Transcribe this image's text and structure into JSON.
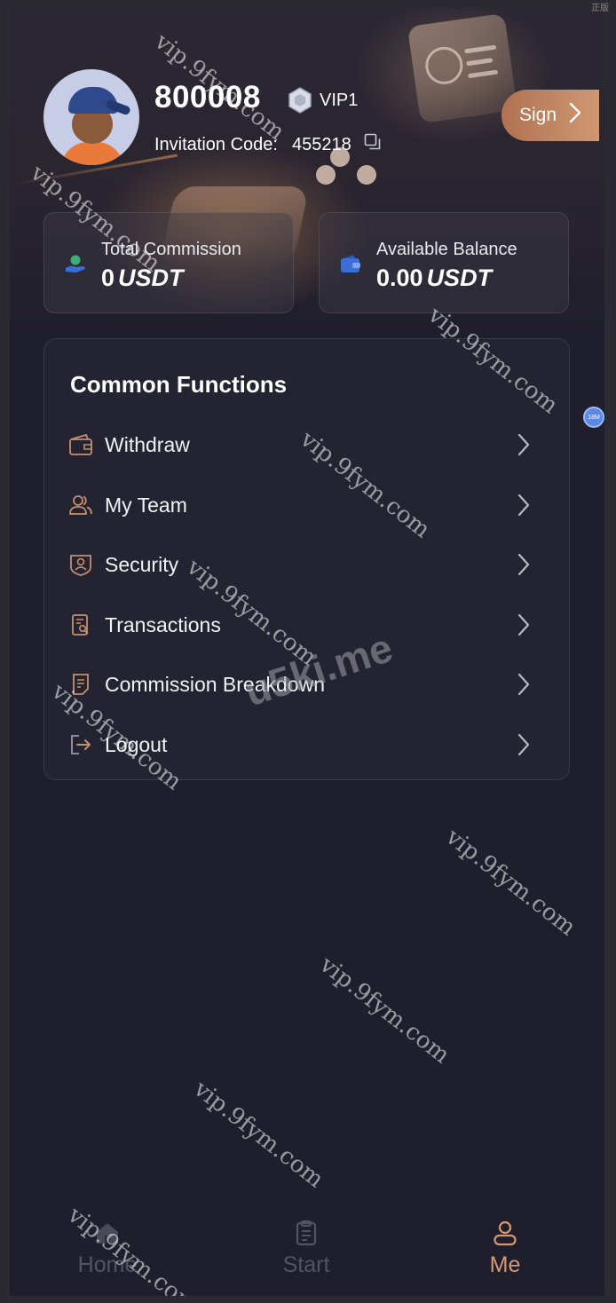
{
  "profile": {
    "user_id": "800008",
    "vip_level": "VIP1",
    "invitation_label": "Invitation Code:",
    "invitation_code": "455218"
  },
  "sign": {
    "label": "Sign"
  },
  "stats": {
    "total_commission": {
      "label": "Total Commission",
      "value": "0",
      "unit": "USDT"
    },
    "available_balance": {
      "label": "Available Balance",
      "value": "0.00",
      "unit": "USDT"
    }
  },
  "functions": {
    "title": "Common Functions",
    "items": [
      {
        "label": "Withdraw",
        "icon": "wallet-icon"
      },
      {
        "label": "My Team",
        "icon": "team-icon"
      },
      {
        "label": "Security",
        "icon": "shield-user-icon"
      },
      {
        "label": "Transactions",
        "icon": "search-document-icon"
      },
      {
        "label": "Commission Breakdown",
        "icon": "list-document-icon"
      },
      {
        "label": "Logout",
        "icon": "logout-icon"
      }
    ]
  },
  "float_badge": "18M",
  "tabs": [
    {
      "label": "Home",
      "icon": "home-icon",
      "active": false
    },
    {
      "label": "Start",
      "icon": "clipboard-icon",
      "active": false
    },
    {
      "label": "Me",
      "icon": "user-icon",
      "active": true
    }
  ],
  "colors": {
    "accent": "#d69a72",
    "background": "#1f1e2c",
    "card": "#242331"
  },
  "overlay": {
    "corner": "正版",
    "watermark": "vip.9fym.com",
    "big_watermark": "u5ki.me"
  }
}
